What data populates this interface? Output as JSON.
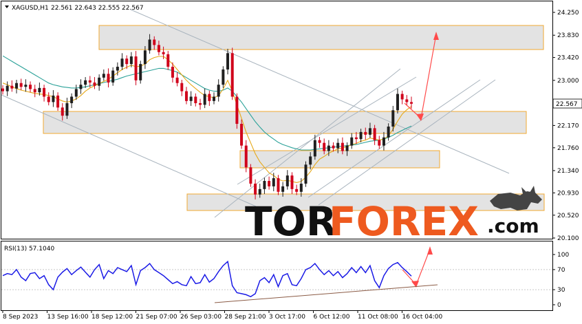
{
  "chart_data": {
    "type": "line",
    "symbol": "XAGUSD,H1",
    "ohlc_values": "22.561 22.643 22.555 22.567",
    "last_price": "22.567",
    "price_axis": {
      "ylim": [
        20.1,
        24.25
      ],
      "ticks": [
        "24.250",
        "23.830",
        "23.420",
        "23.000",
        "22.580",
        "22.170",
        "21.760",
        "21.340",
        "20.930",
        "20.520",
        "20.100"
      ]
    },
    "time_axis": {
      "labels": [
        "8 Sep 2023",
        "13 Sep 16:00",
        "18 Sep 12:00",
        "21 Sep 07:00",
        "26 Sep 03:00",
        "28 Sep 21:00",
        "3 Oct 17:00",
        "6 Oct 12:00",
        "11 Oct 08:00",
        "16 Oct 04:00"
      ]
    },
    "price_series_close": [
      22.8,
      22.9,
      22.85,
      22.95,
      22.88,
      22.92,
      22.84,
      22.78,
      22.86,
      22.7,
      22.6,
      22.72,
      22.5,
      22.35,
      22.58,
      22.7,
      22.84,
      22.92,
      23.0,
      22.96,
      22.9,
      23.05,
      23.12,
      22.96,
      23.18,
      23.25,
      23.4,
      23.3,
      23.44,
      23.0,
      23.3,
      23.55,
      23.75,
      23.65,
      23.52,
      23.48,
      23.25,
      23.05,
      22.95,
      22.8,
      22.62,
      22.7,
      22.58,
      22.55,
      22.75,
      22.62,
      22.7,
      22.92,
      23.2,
      23.5,
      22.7,
      22.2,
      21.8,
      21.4,
      21.1,
      20.9,
      21.0,
      21.15,
      21.05,
      21.2,
      20.95,
      21.05,
      21.25,
      21.0,
      20.95,
      21.1,
      21.45,
      21.6,
      21.9,
      21.85,
      21.7,
      21.8,
      21.75,
      21.85,
      21.7,
      21.8,
      21.95,
      21.92,
      22.05,
      22.0,
      22.12,
      21.9,
      21.8,
      21.95,
      22.15,
      22.45,
      22.75,
      22.65,
      22.6,
      22.57
    ],
    "ma_series": [
      {
        "name": "",
        "color": "#2aa198",
        "values": [
          23.45,
          23.4,
          23.35,
          23.3,
          23.25,
          23.2,
          23.15,
          23.1,
          23.05,
          23.0,
          22.95,
          22.92,
          22.9,
          22.88,
          22.87,
          22.86,
          22.86,
          22.87,
          22.88,
          22.9,
          22.92,
          22.94,
          22.96,
          22.98,
          23.0,
          23.02,
          23.05,
          23.08,
          23.1,
          23.12,
          23.14,
          23.16,
          23.18,
          23.2,
          23.22,
          23.22,
          23.2,
          23.18,
          23.15,
          23.1,
          23.05,
          23.0,
          22.95,
          22.9,
          22.85,
          22.82,
          22.8,
          22.8,
          22.82,
          22.86,
          22.8,
          22.7,
          22.6,
          22.48,
          22.36,
          22.24,
          22.14,
          22.05,
          21.98,
          21.92,
          21.86,
          21.82,
          21.79,
          21.76,
          21.74,
          21.72,
          21.72,
          21.72,
          21.73,
          21.74,
          21.75,
          21.76,
          21.77,
          21.78,
          21.79,
          21.8,
          21.81,
          21.82,
          21.84,
          21.86,
          21.88,
          21.89,
          21.9,
          21.92,
          21.95,
          21.99,
          22.04,
          22.08,
          22.12,
          22.16
        ]
      },
      {
        "name": "",
        "color": "#e6a817",
        "values": [
          22.95,
          22.92,
          22.88,
          22.85,
          22.82,
          22.8,
          22.78,
          22.76,
          22.75,
          22.74,
          22.72,
          22.7,
          22.66,
          22.62,
          22.6,
          22.62,
          22.66,
          22.72,
          22.8,
          22.86,
          22.9,
          22.94,
          22.98,
          23.02,
          23.08,
          23.14,
          23.2,
          23.24,
          23.28,
          23.25,
          23.26,
          23.3,
          23.38,
          23.42,
          23.44,
          23.44,
          23.38,
          23.3,
          23.2,
          23.1,
          23.0,
          22.92,
          22.85,
          22.78,
          22.72,
          22.7,
          22.68,
          22.72,
          22.84,
          23.0,
          22.8,
          22.55,
          22.3,
          22.05,
          21.85,
          21.65,
          21.5,
          21.4,
          21.3,
          21.25,
          21.18,
          21.15,
          21.16,
          21.14,
          21.12,
          21.14,
          21.22,
          21.32,
          21.45,
          21.55,
          21.6,
          21.66,
          21.7,
          21.74,
          21.76,
          21.78,
          21.82,
          21.84,
          21.88,
          21.9,
          21.94,
          21.92,
          21.9,
          21.92,
          21.98,
          22.1,
          22.25,
          22.38,
          22.46,
          22.52
        ]
      }
    ],
    "rsi": {
      "label": "RSI(13) 57.1040",
      "ticks": [
        "100",
        "70",
        "30",
        "0"
      ],
      "levels": [
        30,
        70
      ],
      "values": [
        58,
        62,
        60,
        70,
        55,
        48,
        62,
        64,
        52,
        58,
        40,
        30,
        55,
        65,
        72,
        60,
        68,
        75,
        65,
        55,
        70,
        80,
        52,
        68,
        62,
        74,
        70,
        66,
        78,
        40,
        68,
        74,
        82,
        70,
        64,
        58,
        50,
        42,
        46,
        40,
        38,
        56,
        42,
        44,
        60,
        45,
        52,
        66,
        78,
        86,
        38,
        24,
        22,
        20,
        16,
        22,
        48,
        54,
        44,
        60,
        36,
        58,
        62,
        40,
        38,
        52,
        70,
        74,
        82,
        70,
        60,
        68,
        58,
        66,
        54,
        62,
        74,
        64,
        76,
        64,
        78,
        48,
        34,
        58,
        72,
        80,
        84,
        74,
        66,
        57
      ]
    }
  },
  "watermark": {
    "tor": "TOR",
    "forex": "FOREX",
    "com": ".com"
  }
}
